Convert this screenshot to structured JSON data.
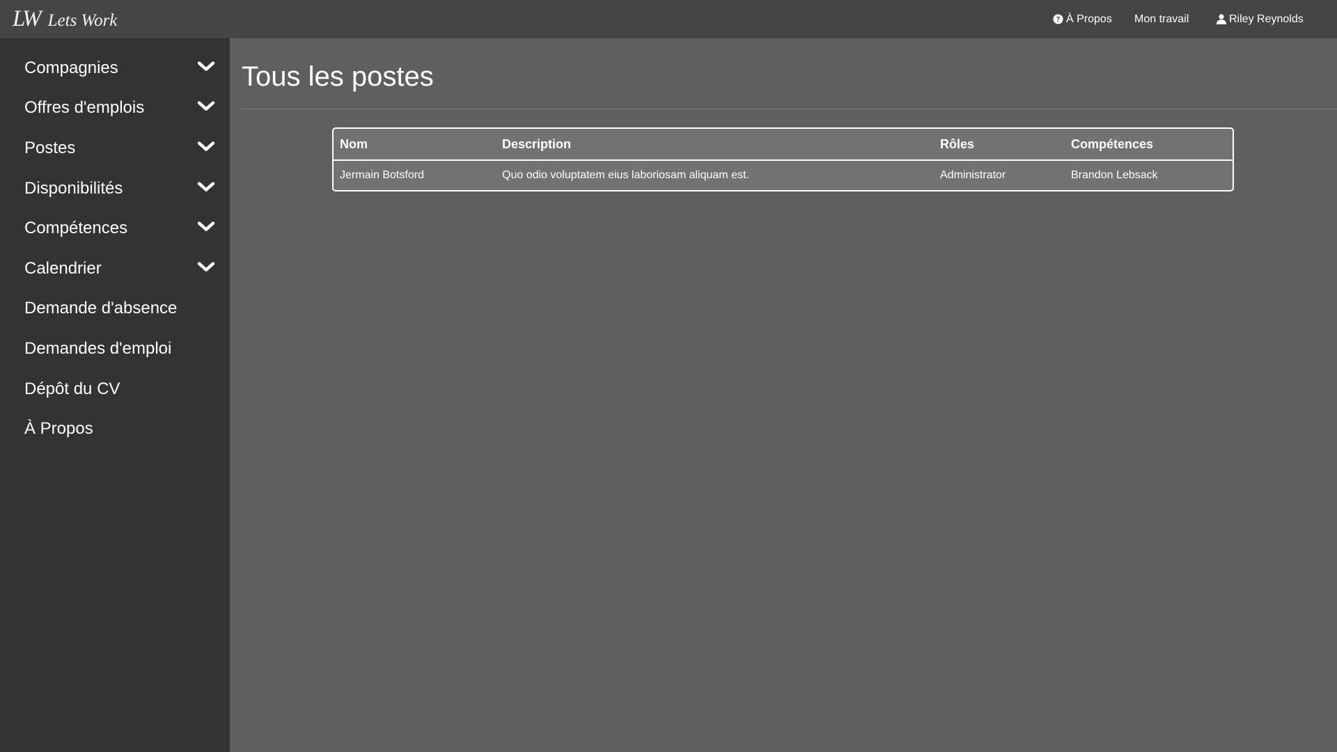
{
  "brand": {
    "mark": "LW",
    "name": "Lets Work"
  },
  "topnav": {
    "about_label": "À Propos",
    "about_icon": "question-circle-icon",
    "work_label": "Mon travail",
    "user_label": "Riley Reynolds",
    "user_icon": "user-icon"
  },
  "sidebar": {
    "items": [
      {
        "label": "Compagnies",
        "icon": "chevron-down-icon"
      },
      {
        "label": "Offres d'emplois",
        "icon": "chevron-down-icon"
      },
      {
        "label": "Postes",
        "icon": "chevron-down-icon"
      },
      {
        "label": "Disponibilités",
        "icon": "chevron-down-icon"
      },
      {
        "label": "Compétences",
        "icon": "chevron-down-icon"
      },
      {
        "label": "Calendrier",
        "icon": "chevron-down-icon"
      },
      {
        "label": "Demande d'absence"
      },
      {
        "label": "Demandes d'emploi"
      },
      {
        "label": "Dépôt du CV"
      },
      {
        "label": "À Propos"
      }
    ]
  },
  "main": {
    "title": "Tous les postes",
    "table": {
      "headers": [
        "Nom",
        "Description",
        "Rôles",
        "Compétences"
      ],
      "rows": [
        [
          "Jermain Botsford",
          "Quo odio voluptatem eius laboriosam aliquam est.",
          "Administrator",
          "Brandon Lebsack"
        ]
      ]
    }
  },
  "colors": {
    "topbar": "#454545",
    "sidebar": "#333333",
    "main_bg": "#5f5f5f",
    "table_bg": "#727272",
    "text": "#ffffff"
  }
}
